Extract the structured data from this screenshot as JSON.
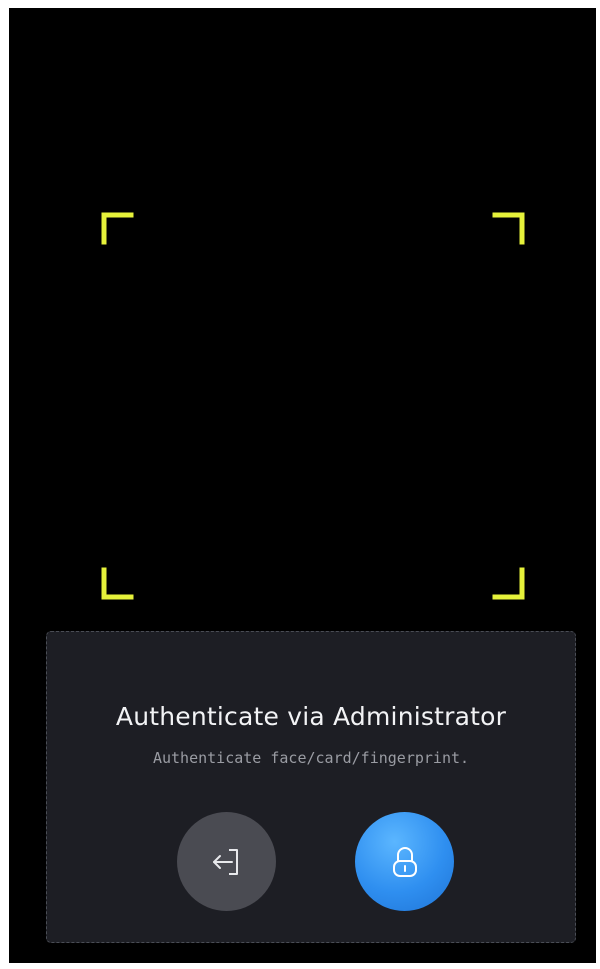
{
  "colors": {
    "background": "#000000",
    "frame_bracket": "#e6f23a",
    "panel": "#1d1e24",
    "exit_button": "#4a4b52",
    "unlock_button": "#2f8ff0"
  },
  "scan_frame": {
    "corners": [
      "top-left",
      "top-right",
      "bottom-left",
      "bottom-right"
    ]
  },
  "panel": {
    "title": "Authenticate via Administrator",
    "subtitle": "Authenticate face/card/fingerprint."
  },
  "actions": {
    "exit_icon": "exit-arrow-icon",
    "unlock_icon": "unlock-padlock-icon"
  }
}
